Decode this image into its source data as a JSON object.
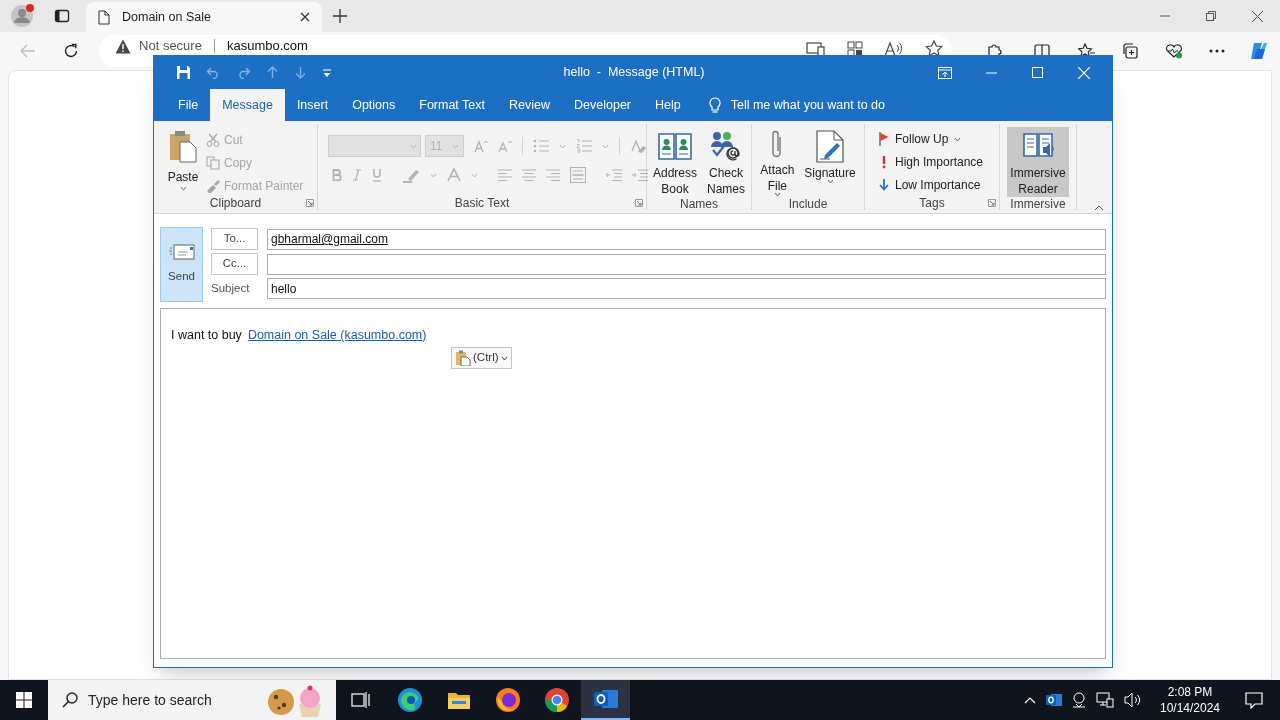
{
  "browser": {
    "tabs": [
      {
        "title": "Domain on Sale",
        "selected": true
      }
    ],
    "address_bar": {
      "security": "Not secure",
      "url": "kasumbo.com"
    }
  },
  "outlook": {
    "title": "hello  -  Message (HTML)",
    "ribbon_tabs": [
      {
        "label": "File",
        "selected": false
      },
      {
        "label": "Message",
        "selected": true
      },
      {
        "label": "Insert",
        "selected": false
      },
      {
        "label": "Options",
        "selected": false
      },
      {
        "label": "Format Text",
        "selected": false
      },
      {
        "label": "Review",
        "selected": false
      },
      {
        "label": "Developer",
        "selected": false
      },
      {
        "label": "Help",
        "selected": false
      }
    ],
    "tell_me": "Tell me what you want to do",
    "groups": [
      {
        "kind": "clipboard",
        "label": "Clipboard",
        "items": [
          {
            "label": "Paste",
            "disabled": false
          },
          {
            "label": "Cut",
            "disabled": true
          },
          {
            "label": "Copy",
            "disabled": true
          },
          {
            "label": "Format Painter",
            "disabled": true
          }
        ]
      },
      {
        "kind": "basic_text",
        "label": "Basic Text",
        "font_size": "11",
        "disabled": true
      },
      {
        "kind": "large",
        "label": "Names",
        "items": [
          {
            "label": "Address\nBook",
            "dropdown": false,
            "highlighted": false
          },
          {
            "label": "Check\nNames",
            "dropdown": false,
            "highlighted": false
          }
        ]
      },
      {
        "kind": "large",
        "label": "Include",
        "items": [
          {
            "label": "Attach\nFile",
            "dropdown": true,
            "highlighted": false
          },
          {
            "label": "Signature",
            "dropdown": true,
            "highlighted": false
          }
        ]
      },
      {
        "kind": "tags",
        "label": "Tags",
        "items": [
          {
            "label": "Follow Up",
            "dropdown": true
          },
          {
            "label": "High Importance",
            "dropdown": false
          },
          {
            "label": "Low Importance",
            "dropdown": false
          }
        ]
      },
      {
        "kind": "large",
        "label": "Immersive",
        "items": [
          {
            "label": "Immersive\nReader",
            "dropdown": false,
            "highlighted": true
          }
        ]
      }
    ],
    "compose": {
      "send": "Send",
      "to_button": "To...",
      "to": "gbharmal@gmail.com",
      "cc_button": "Cc...",
      "subject_label": "Subject",
      "subject": "hello",
      "body_text": "I want to buy",
      "body_link": "Domain on Sale (kasumbo.com)",
      "paste_options": "(Ctrl)"
    }
  },
  "taskbar": {
    "search_placeholder": "Type here to search",
    "apps": [
      {
        "selected": false
      },
      {
        "selected": false
      },
      {
        "selected": false
      },
      {
        "selected": false
      },
      {
        "selected": false
      },
      {
        "selected": true
      }
    ],
    "time": "2:08 PM",
    "date": "10/14/2024"
  }
}
